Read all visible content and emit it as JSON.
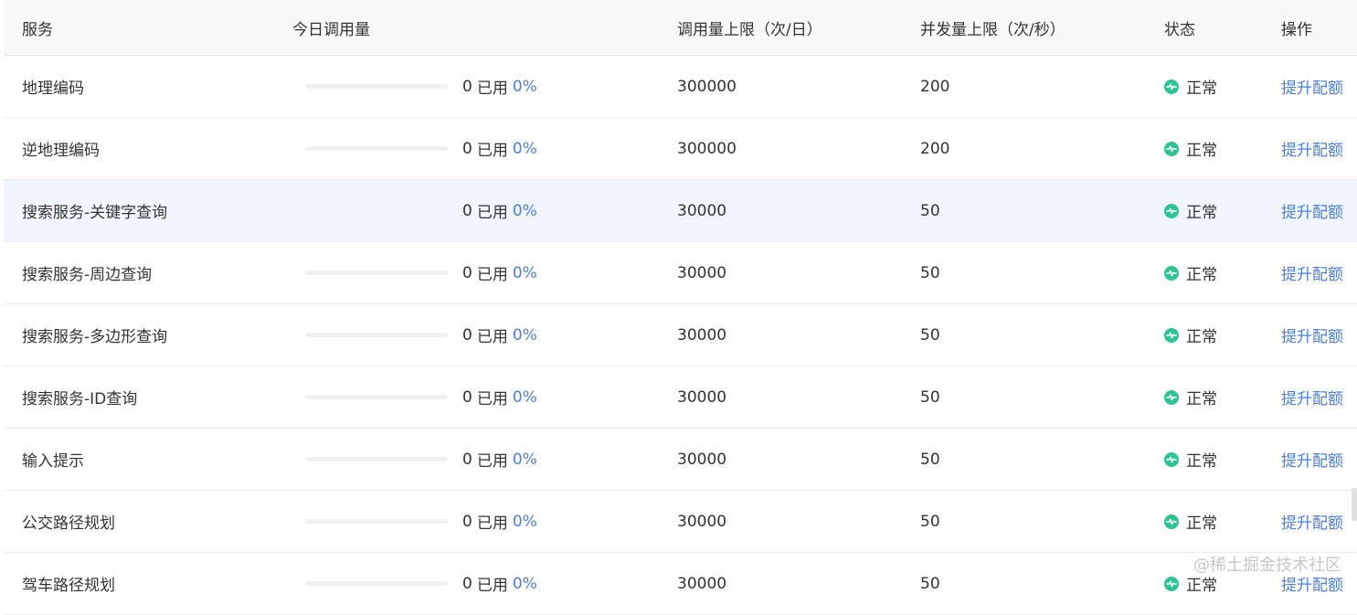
{
  "columns": {
    "service": "服务",
    "usage": "今日调用量",
    "daily_limit": "调用量上限（次/日）",
    "concurrency": "并发量上限（次/秒）",
    "status": "状态",
    "action": "操作"
  },
  "usage_word": "已用",
  "status_text": "正常",
  "action_text": "提升配额",
  "accent_color": "#4a7fdb",
  "status_color": "#2ec492",
  "rows": [
    {
      "service": "地理编码",
      "used": "0",
      "used_fraction": 0,
      "percent": "0%",
      "daily_limit": "300000",
      "concurrency": "200"
    },
    {
      "service": "逆地理编码",
      "used": "0",
      "used_fraction": 0,
      "percent": "0%",
      "daily_limit": "300000",
      "concurrency": "200"
    },
    {
      "service": "搜索服务-关键字查询",
      "used": "0",
      "used_fraction": 0,
      "percent": "0%",
      "daily_limit": "30000",
      "concurrency": "50"
    },
    {
      "service": "搜索服务-周边查询",
      "used": "0",
      "used_fraction": 0,
      "percent": "0%",
      "daily_limit": "30000",
      "concurrency": "50"
    },
    {
      "service": "搜索服务-多边形查询",
      "used": "0",
      "used_fraction": 0,
      "percent": "0%",
      "daily_limit": "30000",
      "concurrency": "50"
    },
    {
      "service": "搜索服务-ID查询",
      "used": "0",
      "used_fraction": 0,
      "percent": "0%",
      "daily_limit": "30000",
      "concurrency": "50"
    },
    {
      "service": "输入提示",
      "used": "0",
      "used_fraction": 0,
      "percent": "0%",
      "daily_limit": "30000",
      "concurrency": "50"
    },
    {
      "service": "公交路径规划",
      "used": "0",
      "used_fraction": 0,
      "percent": "0%",
      "daily_limit": "30000",
      "concurrency": "50"
    },
    {
      "service": "驾车路径规划",
      "used": "0",
      "used_fraction": 0,
      "percent": "0%",
      "daily_limit": "30000",
      "concurrency": "50"
    }
  ],
  "watermark": "@稀土掘金技术社区"
}
